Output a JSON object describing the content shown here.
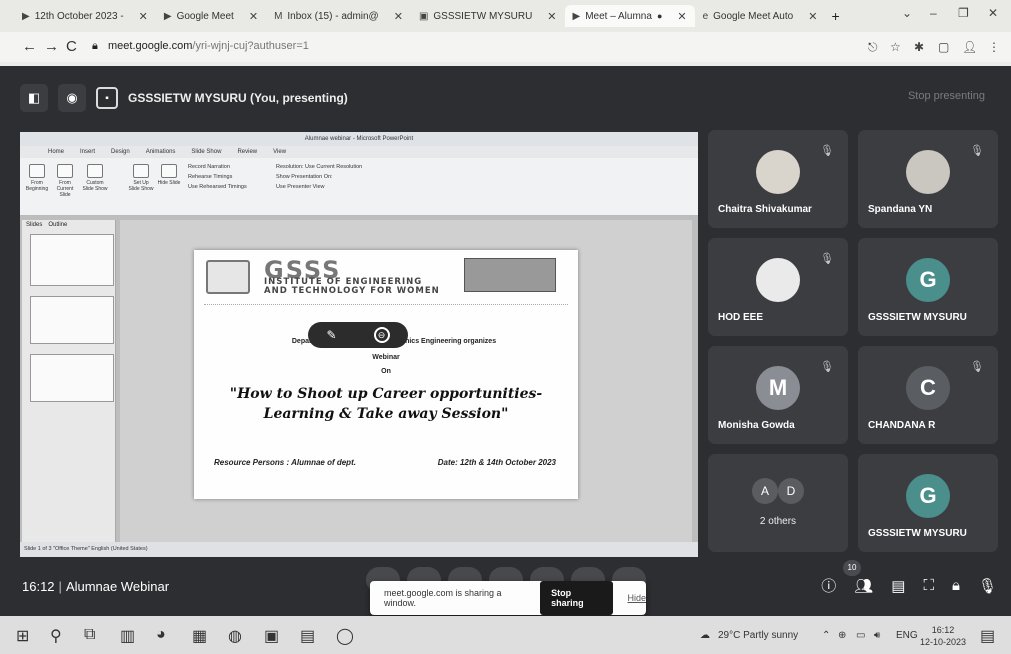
{
  "browser": {
    "tabs": [
      {
        "label": "12th October 2023 -",
        "icon": "meet-icon"
      },
      {
        "label": "Google Meet",
        "icon": "meet-icon"
      },
      {
        "label": "Inbox (15) - admin@",
        "icon": "gmail-icon"
      },
      {
        "label": "GSSSIETW MYSURU",
        "icon": "page-icon"
      },
      {
        "label": "Meet – Alumna",
        "icon": "meet-icon"
      },
      {
        "label": "Google Meet Auto",
        "icon": "extension-icon"
      }
    ],
    "new_tab": "+",
    "url_domain": "meet.google.com",
    "url_path": "/yri-wjnj-cuj?authuser=1"
  },
  "meet": {
    "presenter_label": "GSSSIETW MYSURU (You, presenting)",
    "stop_presenting": "Stop presenting",
    "participants": [
      {
        "name": "Chaitra Shivakumar",
        "type": "photo",
        "muted": true
      },
      {
        "name": "Spandana YN",
        "type": "photo",
        "muted": true
      },
      {
        "name": "HOD EEE",
        "type": "photo",
        "muted": true
      },
      {
        "name": "GSSSIETW MYSURU",
        "type": "initial",
        "initial": "G",
        "color": "#4b8f8c",
        "muted": false
      },
      {
        "name": "Monisha Gowda",
        "type": "initial",
        "initial": "M",
        "color": "#8a8e94",
        "muted": true
      },
      {
        "name": "CHANDANA R",
        "type": "initial",
        "initial": "C",
        "color": "#5a5d62",
        "muted": true
      },
      {
        "name": "2 others",
        "type": "group",
        "initials": [
          "A",
          "D"
        ],
        "muted": false
      },
      {
        "name": "GSSSIETW MYSURU",
        "type": "initial",
        "initial": "G",
        "color": "#4b8f8c",
        "muted": false
      }
    ],
    "meeting_time": "16:12",
    "meeting_name": "Alumnae Webinar",
    "participant_count": "10",
    "share_bar": {
      "message": "meet.google.com is sharing a window.",
      "stop_label": "Stop sharing",
      "hide_label": "Hide"
    }
  },
  "powerpoint": {
    "window_title": "Alumnae webinar - Microsoft PowerPoint",
    "menu_tabs": [
      "Home",
      "Insert",
      "Design",
      "Animations",
      "Slide Show",
      "Review",
      "View"
    ],
    "ribbon_buttons": [
      "From Beginning",
      "From Current Slide",
      "Custom Slide Show",
      "Set Up Slide Show",
      "Hide Slide"
    ],
    "ribbon_options": [
      "Record Narration",
      "Rehearse Timings",
      "Use Rehearsed Timings",
      "Resolution: Use Current Resolution",
      "Show Presentation On:",
      "Use Presenter View"
    ],
    "pane_tabs": [
      "Slides",
      "Outline"
    ],
    "status": "Slide 1 of 3   \"Office Theme\"   English (United States)"
  },
  "slide": {
    "org_short": "GSSS",
    "org_line1": "INSTITUTE OF ENGINEERING",
    "org_line2": "AND TECHNOLOGY FOR WOMEN",
    "dept_text": "Department of Electrical & Electronics Engineering organizes",
    "event_type": "Webinar",
    "on_text": "On",
    "talk_title": "\"How to Shoot up Career opportunities- Learning & Take away Session\"",
    "resource": "Resource Persons : Alumnae of dept.",
    "date_text": "Date: 12th & 14th October 2023"
  },
  "taskbar": {
    "weather": "29°C  Partly sunny",
    "language": "ENG",
    "time": "16:12",
    "date": "12-10-2023"
  }
}
